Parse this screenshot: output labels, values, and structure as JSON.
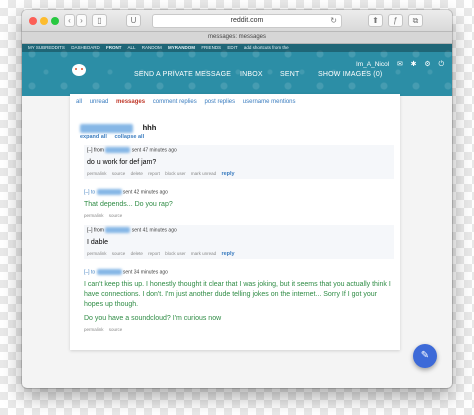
{
  "browser": {
    "url": "reddit.com",
    "tab_title": "messages: messages",
    "back_glyph": "‹",
    "forward_glyph": "›",
    "sidebar_glyph": "▯",
    "extension_glyph": "U",
    "reload_glyph": "↻",
    "share_glyph": "⬆",
    "font_glyph": "ƒ",
    "tabs_glyph": "⧉"
  },
  "colors": {
    "header": "#2c8ea6",
    "active_tab": "#c0392b",
    "link": "#3a7cbf",
    "outgoing": "#2f8c45",
    "fab": "#3d6ad8"
  },
  "header": {
    "sr_links": [
      "MY SUBREDDITS",
      "DASHBOARD",
      "FRONT",
      "ALL",
      "RANDOM",
      "MYRANDOM",
      "FRIENDS",
      "EDIT",
      "add shortcuts from the"
    ],
    "nav": [
      "SEND A PRIVATE MESSAGE",
      "INBOX",
      "SENT",
      "SHOW IMAGES (0)"
    ],
    "username": "Im_A_Nicol",
    "mail_icon": "✉",
    "tools_icon": "✱",
    "settings_icon": "⚙",
    "power_icon": "⏻"
  },
  "subtabs": [
    "all",
    "unread",
    "messages",
    "comment replies",
    "post replies",
    "username mentions"
  ],
  "thread": {
    "subject": "hhh",
    "subject_user": "xxxxxxxxxxxxxx",
    "expand_all": "expand all",
    "collapse_all": "collapse all"
  },
  "messages": [
    {
      "direction": "from",
      "toggle": "[–]",
      "user": "xxxxxxxxxx",
      "time": "sent 47 minutes ago",
      "body": "do u work for def jam?",
      "actions": [
        "permalink",
        "source",
        "delete",
        "report",
        "block user",
        "mark unread"
      ],
      "reply": "reply"
    },
    {
      "direction": "to",
      "toggle": "[–]",
      "user": "xxxxxxxxxx",
      "time": "sent 42 minutes ago",
      "body": "That depends... Do you rap?",
      "actions": [
        "permalink",
        "source"
      ]
    },
    {
      "direction": "from",
      "toggle": "[–]",
      "user": "xxxxxxxxxx",
      "time": "sent 41 minutes ago",
      "body": "I dable",
      "actions": [
        "permalink",
        "source",
        "delete",
        "report",
        "block user",
        "mark unread"
      ],
      "reply": "reply"
    },
    {
      "direction": "to",
      "toggle": "[–]",
      "user": "xxxxxxxxxx",
      "time": "sent 34 minutes ago",
      "body": "I can't keep this up. I honestly thought it clear that I was joking, but it seems that you actually think I have connections. I don't. I'm just another dude telling jokes on the internet... Sorry If I got your hopes up though.",
      "body2": "Do you have a soundcloud? I'm curious now",
      "actions": [
        "permalink",
        "source"
      ]
    }
  ],
  "fab_icon": "✎"
}
